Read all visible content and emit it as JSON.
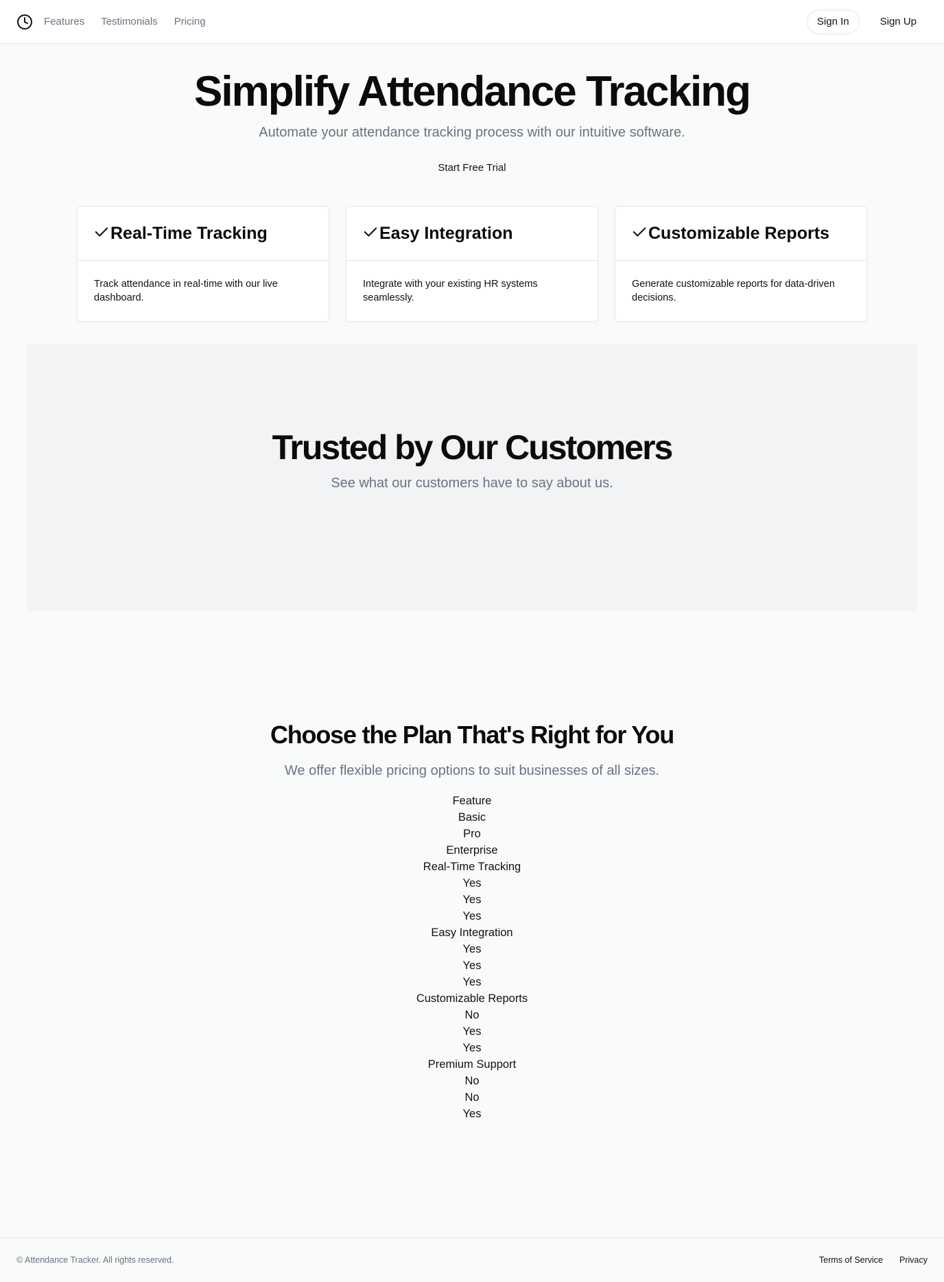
{
  "header": {
    "logo_icon": "clock-icon",
    "nav": [
      {
        "label": "Features"
      },
      {
        "label": "Testimonials"
      },
      {
        "label": "Pricing"
      }
    ],
    "sign_in_label": "Sign In",
    "sign_up_label": "Sign Up"
  },
  "hero": {
    "title": "Simplify Attendance Tracking",
    "subtitle": "Automate your attendance tracking process with our intuitive software.",
    "cta_label": "Start Free Trial"
  },
  "features": [
    {
      "icon": "check-icon",
      "title": "Real-Time Tracking",
      "description": "Track attendance in real-time with our live dashboard."
    },
    {
      "icon": "check-icon",
      "title": "Easy Integration",
      "description": "Integrate with your existing HR systems seamlessly."
    },
    {
      "icon": "check-icon",
      "title": "Customizable Reports",
      "description": "Generate customizable reports for data-driven decisions."
    }
  ],
  "testimonials": {
    "title": "Trusted by Our Customers",
    "subtitle": "See what our customers have to say about us."
  },
  "pricing": {
    "title": "Choose the Plan That's Right for You",
    "subtitle": "We offer flexible pricing options to suit businesses of all sizes.",
    "headers": [
      "Feature",
      "Basic",
      "Pro",
      "Enterprise"
    ],
    "rows": [
      [
        "Real-Time Tracking",
        "Yes",
        "Yes",
        "Yes"
      ],
      [
        "Easy Integration",
        "Yes",
        "Yes",
        "Yes"
      ],
      [
        "Customizable Reports",
        "No",
        "Yes",
        "Yes"
      ],
      [
        "Premium Support",
        "No",
        "No",
        "Yes"
      ]
    ]
  },
  "footer": {
    "copyright": "© Attendance Tracker. All rights reserved.",
    "links": [
      {
        "label": "Terms of Service"
      },
      {
        "label": "Privacy"
      }
    ]
  },
  "colors": {
    "background": "#f9fafa",
    "muted_text": "#6b7280",
    "section_bg": "#f2f3f5",
    "border": "#e5e7eb"
  }
}
